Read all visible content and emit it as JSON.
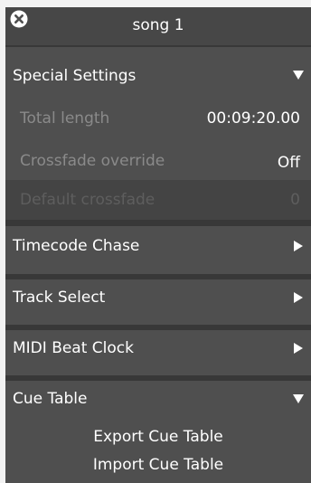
{
  "titlebar": {
    "title": "song 1",
    "close_icon": "close-circle-icon"
  },
  "sections": {
    "special_settings": {
      "label": "Special Settings",
      "expanded": true,
      "rows": {
        "total_length": {
          "label": "Total length",
          "value": "00:09:20.00"
        },
        "crossfade_override": {
          "label": "Crossfade override",
          "value": "Off"
        },
        "default_crossfade": {
          "label": "Default crossfade",
          "value": "0"
        }
      }
    },
    "timecode_chase": {
      "label": "Timecode Chase",
      "expanded": false
    },
    "track_select": {
      "label": "Track Select",
      "expanded": false
    },
    "midi_beat_clock": {
      "label": "MIDI Beat Clock",
      "expanded": false
    },
    "cue_table": {
      "label": "Cue Table",
      "expanded": true,
      "export_label": "Export Cue Table",
      "import_label": "Import Cue Table"
    }
  },
  "colors": {
    "panel_bg": "#4f4f4f",
    "separator": "#383838",
    "dim_text": "#8a8a8a",
    "disabled_text": "#5e5e5e"
  }
}
